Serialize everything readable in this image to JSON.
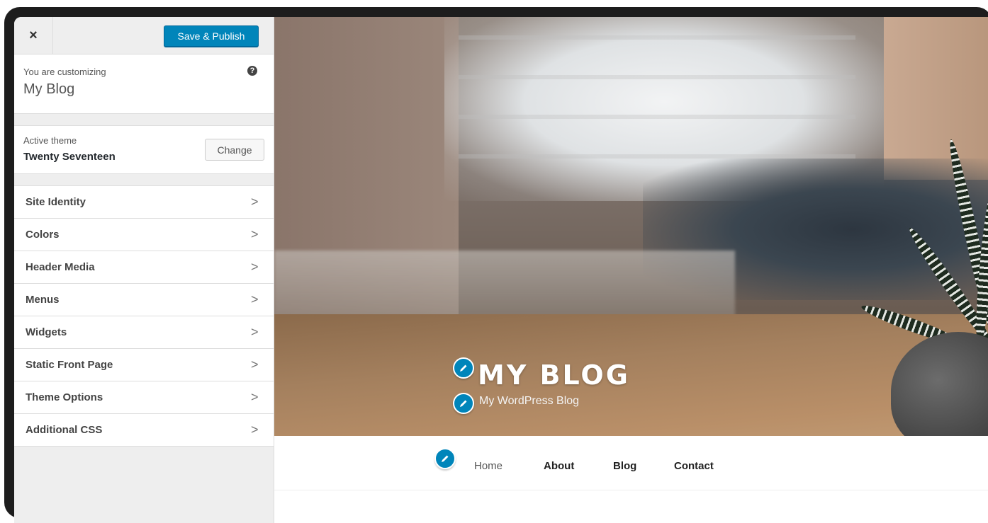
{
  "sidebar": {
    "close_label": "×",
    "publish_label": "Save & Publish",
    "customizing_label": "You are customizing",
    "site_name": "My Blog",
    "help_glyph": "?",
    "theme": {
      "label": "Active theme",
      "name": "Twenty Seventeen",
      "change_label": "Change"
    },
    "sections": [
      {
        "label": "Site Identity"
      },
      {
        "label": "Colors"
      },
      {
        "label": "Header Media"
      },
      {
        "label": "Menus"
      },
      {
        "label": "Widgets"
      },
      {
        "label": "Static Front Page"
      },
      {
        "label": "Theme Options"
      },
      {
        "label": "Additional CSS"
      }
    ],
    "chevron_glyph": ">"
  },
  "preview": {
    "site_title": "MY BLOG",
    "tagline": "My WordPress Blog",
    "menu": [
      "Home",
      "About",
      "Blog",
      "Contact"
    ]
  },
  "colors": {
    "primary_button": "#0085ba",
    "sidebar_bg": "#eeeeee",
    "panel_bg": "#ffffff"
  },
  "icons": {
    "close": "close-icon",
    "help": "help-icon",
    "chevron": "chevron-right-icon",
    "edit": "pencil-icon"
  }
}
